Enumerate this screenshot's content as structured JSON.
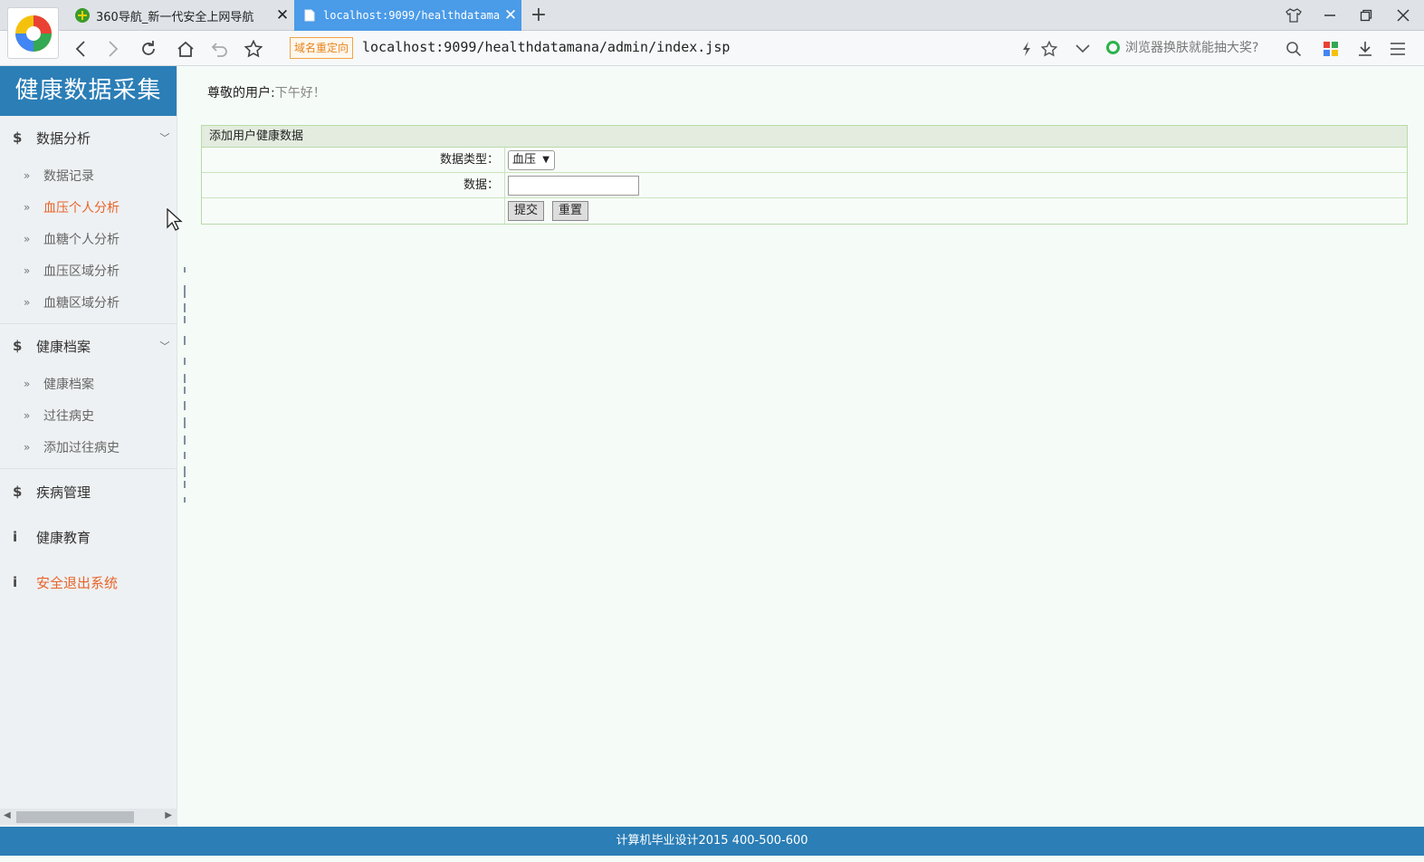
{
  "browser": {
    "tabs": [
      {
        "label": "360导航_新一代安全上网导航"
      },
      {
        "label": "localhost:9099/healthdataman"
      }
    ],
    "redirect_badge": "域名重定向",
    "url": "localhost:9099/healthdatamana/admin/index.jsp",
    "search_hint": "浏览器换肤就能抽大奖?"
  },
  "sidebar": {
    "brand": "健康数据采集",
    "groups": [
      {
        "label": "数据分析",
        "icon": "$",
        "items": [
          "数据记录",
          "血压个人分析",
          "血糖个人分析",
          "血压区域分析",
          "血糖区域分析"
        ]
      },
      {
        "label": "健康档案",
        "icon": "$",
        "items": [
          "健康档案",
          "过往病史",
          "添加过往病史"
        ]
      },
      {
        "label": "疾病管理",
        "icon": "$"
      },
      {
        "label": "健康教育",
        "icon": "i"
      },
      {
        "label": "安全退出系统",
        "icon": "i"
      }
    ]
  },
  "greeting": {
    "prefix": "尊敬的用户:",
    "time": "下午好！"
  },
  "form": {
    "title": "添加用户健康数据",
    "type_label": "数据类型：",
    "type_selected": "血压",
    "data_label": "数据：",
    "data_value": "",
    "submit": "提交",
    "reset": "重置"
  },
  "footer": {
    "text": "计算机毕业设计2015  400-500-600"
  },
  "colors": {
    "brand_blue": "#2b7eb6",
    "accent_orange": "#e8642a",
    "active_tab": "#4a9be8"
  }
}
